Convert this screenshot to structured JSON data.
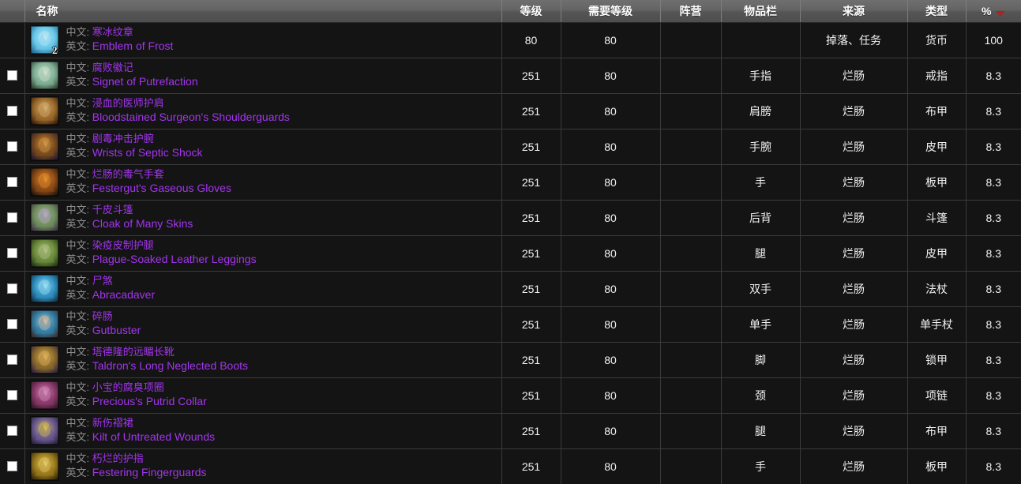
{
  "table": {
    "columns": [
      {
        "key": "check",
        "label": "",
        "name": "select-all-column"
      },
      {
        "key": "name",
        "label": "名称",
        "name": "column-name"
      },
      {
        "key": "level",
        "label": "等级",
        "name": "column-level"
      },
      {
        "key": "req_level",
        "label": "需要等级",
        "name": "column-required-level"
      },
      {
        "key": "faction",
        "label": "阵营",
        "name": "column-faction"
      },
      {
        "key": "slot",
        "label": "物品栏",
        "name": "column-slot"
      },
      {
        "key": "source",
        "label": "来源",
        "name": "column-source"
      },
      {
        "key": "type",
        "label": "类型",
        "name": "column-type"
      },
      {
        "key": "pct",
        "label": "%",
        "name": "column-percent"
      }
    ],
    "sort": {
      "column": "%",
      "direction": "desc",
      "arrow_color": "#b02020"
    },
    "labels": {
      "cn": "中文:",
      "en": "英文:"
    },
    "quality_color": "#a335ee",
    "rows": [
      {
        "checkbox": false,
        "has_checkbox": false,
        "quantity": "2",
        "icon": "emblem-of-frost-icon",
        "icon_colors": [
          "#1c5f8a",
          "#69c8e8",
          "#bfe9f6"
        ],
        "name_cn": "寒冰纹章",
        "name_en": "Emblem of Frost",
        "level": "80",
        "req_level": "80",
        "faction": "",
        "slot": "",
        "source": "掉落、任务",
        "type": "货币",
        "pct": "100"
      },
      {
        "checkbox": false,
        "has_checkbox": true,
        "quantity": "",
        "icon": "signet-of-putrefaction-icon",
        "icon_colors": [
          "#2b3a2a",
          "#7fae96",
          "#cfe3d0"
        ],
        "name_cn": "腐败徽记",
        "name_en": "Signet of Putrefaction",
        "level": "251",
        "req_level": "80",
        "faction": "",
        "slot": "手指",
        "source": "烂肠",
        "type": "戒指",
        "pct": "8.3"
      },
      {
        "checkbox": false,
        "has_checkbox": true,
        "quantity": "",
        "icon": "bloodstained-surgeons-shoulderguards-icon",
        "icon_colors": [
          "#2a1408",
          "#9a6a2c",
          "#d8b173"
        ],
        "name_cn": "浸血的医师护肩",
        "name_en": "Bloodstained Surgeon's Shoulderguards",
        "level": "251",
        "req_level": "80",
        "faction": "",
        "slot": "肩膀",
        "source": "烂肠",
        "type": "布甲",
        "pct": "8.3"
      },
      {
        "checkbox": false,
        "has_checkbox": true,
        "quantity": "",
        "icon": "wrists-of-septic-shock-icon",
        "icon_colors": [
          "#1c1630",
          "#7a4a1c",
          "#d79a4a"
        ],
        "name_cn": "剧毒冲击护腕",
        "name_en": "Wrists of Septic Shock",
        "level": "251",
        "req_level": "80",
        "faction": "",
        "slot": "手腕",
        "source": "烂肠",
        "type": "皮甲",
        "pct": "8.3"
      },
      {
        "checkbox": false,
        "has_checkbox": true,
        "quantity": "",
        "icon": "festerguts-gaseous-gloves-icon",
        "icon_colors": [
          "#14100c",
          "#8c4a16",
          "#e8902e"
        ],
        "name_cn": "烂肠的毒气手套",
        "name_en": "Festergut's Gaseous Gloves",
        "level": "251",
        "req_level": "80",
        "faction": "",
        "slot": "手",
        "source": "烂肠",
        "type": "板甲",
        "pct": "8.3"
      },
      {
        "checkbox": false,
        "has_checkbox": true,
        "quantity": "",
        "icon": "cloak-of-many-skins-icon",
        "icon_colors": [
          "#3a2c48",
          "#6f8f5a",
          "#b9a9c8"
        ],
        "name_cn": "千皮斗篷",
        "name_en": "Cloak of Many Skins",
        "level": "251",
        "req_level": "80",
        "faction": "",
        "slot": "后背",
        "source": "烂肠",
        "type": "斗篷",
        "pct": "8.3"
      },
      {
        "checkbox": false,
        "has_checkbox": true,
        "quantity": "",
        "icon": "plague-soaked-leather-leggings-icon",
        "icon_colors": [
          "#1e2a14",
          "#6b8a3a",
          "#b3c48a"
        ],
        "name_cn": "染疫皮制护腿",
        "name_en": "Plague-Soaked Leather Leggings",
        "level": "251",
        "req_level": "80",
        "faction": "",
        "slot": "腿",
        "source": "烂肠",
        "type": "皮甲",
        "pct": "8.3"
      },
      {
        "checkbox": false,
        "has_checkbox": true,
        "quantity": "",
        "icon": "abracadaver-icon",
        "icon_colors": [
          "#102a3c",
          "#2f8fc0",
          "#9fe4f8"
        ],
        "name_cn": "尸煞",
        "name_en": "Abracadaver",
        "level": "251",
        "req_level": "80",
        "faction": "",
        "slot": "双手",
        "source": "烂肠",
        "type": "法杖",
        "pct": "8.3"
      },
      {
        "checkbox": false,
        "has_checkbox": true,
        "quantity": "",
        "icon": "gutbuster-icon",
        "icon_colors": [
          "#3a2420",
          "#2f7fa8",
          "#d8c0a8"
        ],
        "name_cn": "碎肠",
        "name_en": "Gutbuster",
        "level": "251",
        "req_level": "80",
        "faction": "",
        "slot": "单手",
        "source": "烂肠",
        "type": "单手杖",
        "pct": "8.3"
      },
      {
        "checkbox": false,
        "has_checkbox": true,
        "quantity": "",
        "icon": "taldrons-long-neglected-boots-icon",
        "icon_colors": [
          "#231a42",
          "#8a6a2a",
          "#e0b45c"
        ],
        "name_cn": "塔德隆的远睸长靴",
        "name_en": "Taldron's Long Neglected Boots",
        "level": "251",
        "req_level": "80",
        "faction": "",
        "slot": "脚",
        "source": "烂肠",
        "type": "锁甲",
        "pct": "8.3"
      },
      {
        "checkbox": false,
        "has_checkbox": true,
        "quantity": "",
        "icon": "preciouss-putrid-collar-icon",
        "icon_colors": [
          "#2a1622",
          "#8a3a6a",
          "#d890c0"
        ],
        "name_cn": "小宝的腐臭项圈",
        "name_en": "Precious's Putrid Collar",
        "level": "251",
        "req_level": "80",
        "faction": "",
        "slot": "颈",
        "source": "烂肠",
        "type": "项链",
        "pct": "8.3"
      },
      {
        "checkbox": false,
        "has_checkbox": true,
        "quantity": "",
        "icon": "kilt-of-untreated-wounds-icon",
        "icon_colors": [
          "#241c38",
          "#6a5a90",
          "#d8c050"
        ],
        "name_cn": "新伤褶裙",
        "name_en": "Kilt of Untreated Wounds",
        "level": "251",
        "req_level": "80",
        "faction": "",
        "slot": "腿",
        "source": "烂肠",
        "type": "布甲",
        "pct": "8.3"
      },
      {
        "checkbox": false,
        "has_checkbox": true,
        "quantity": "",
        "icon": "festering-fingerguards-icon",
        "icon_colors": [
          "#2a1e0c",
          "#9a7a1c",
          "#e8cc6a"
        ],
        "name_cn": "朽烂的护指",
        "name_en": "Festering Fingerguards",
        "level": "251",
        "req_level": "80",
        "faction": "",
        "slot": "手",
        "source": "烂肠",
        "type": "板甲",
        "pct": "8.3"
      }
    ]
  }
}
